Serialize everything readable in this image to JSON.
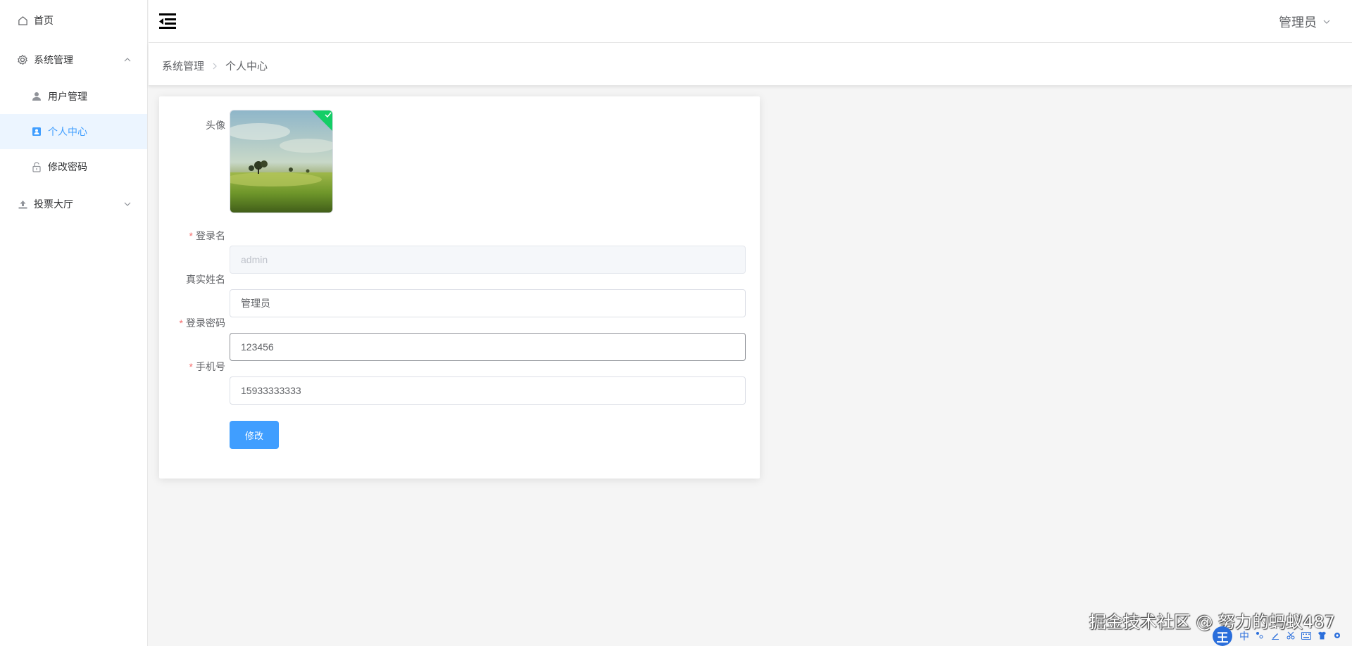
{
  "sidebar": {
    "items": [
      {
        "label": "首页",
        "icon": "home-icon"
      },
      {
        "label": "系统管理",
        "icon": "gear-icon",
        "expanded": true
      },
      {
        "label": "用户管理",
        "icon": "user-icon"
      },
      {
        "label": "个人中心",
        "icon": "user-card-icon",
        "active": true
      },
      {
        "label": "修改密码",
        "icon": "unlock-icon"
      },
      {
        "label": "投票大厅",
        "icon": "upload-icon",
        "expanded": false
      }
    ]
  },
  "header": {
    "user_label": "管理员"
  },
  "breadcrumb": {
    "parent": "系统管理",
    "current": "个人中心"
  },
  "form": {
    "avatar_label": "头像",
    "login_name_label": "登录名",
    "login_name_value": "admin",
    "real_name_label": "真实姓名",
    "real_name_value": "管理员",
    "password_label": "登录密码",
    "password_value": "123456",
    "phone_label": "手机号",
    "phone_value": "15933333333",
    "required_mark": "*",
    "submit_label": "修改"
  },
  "watermark": "掘金技术社区 @ 努力的蚂蚁487",
  "ime": {
    "logo": "王",
    "mode": "中"
  },
  "colors": {
    "accent": "#409eff",
    "active_bg": "#ecf5ff",
    "required": "#f56c6c",
    "success": "#13ce66"
  }
}
